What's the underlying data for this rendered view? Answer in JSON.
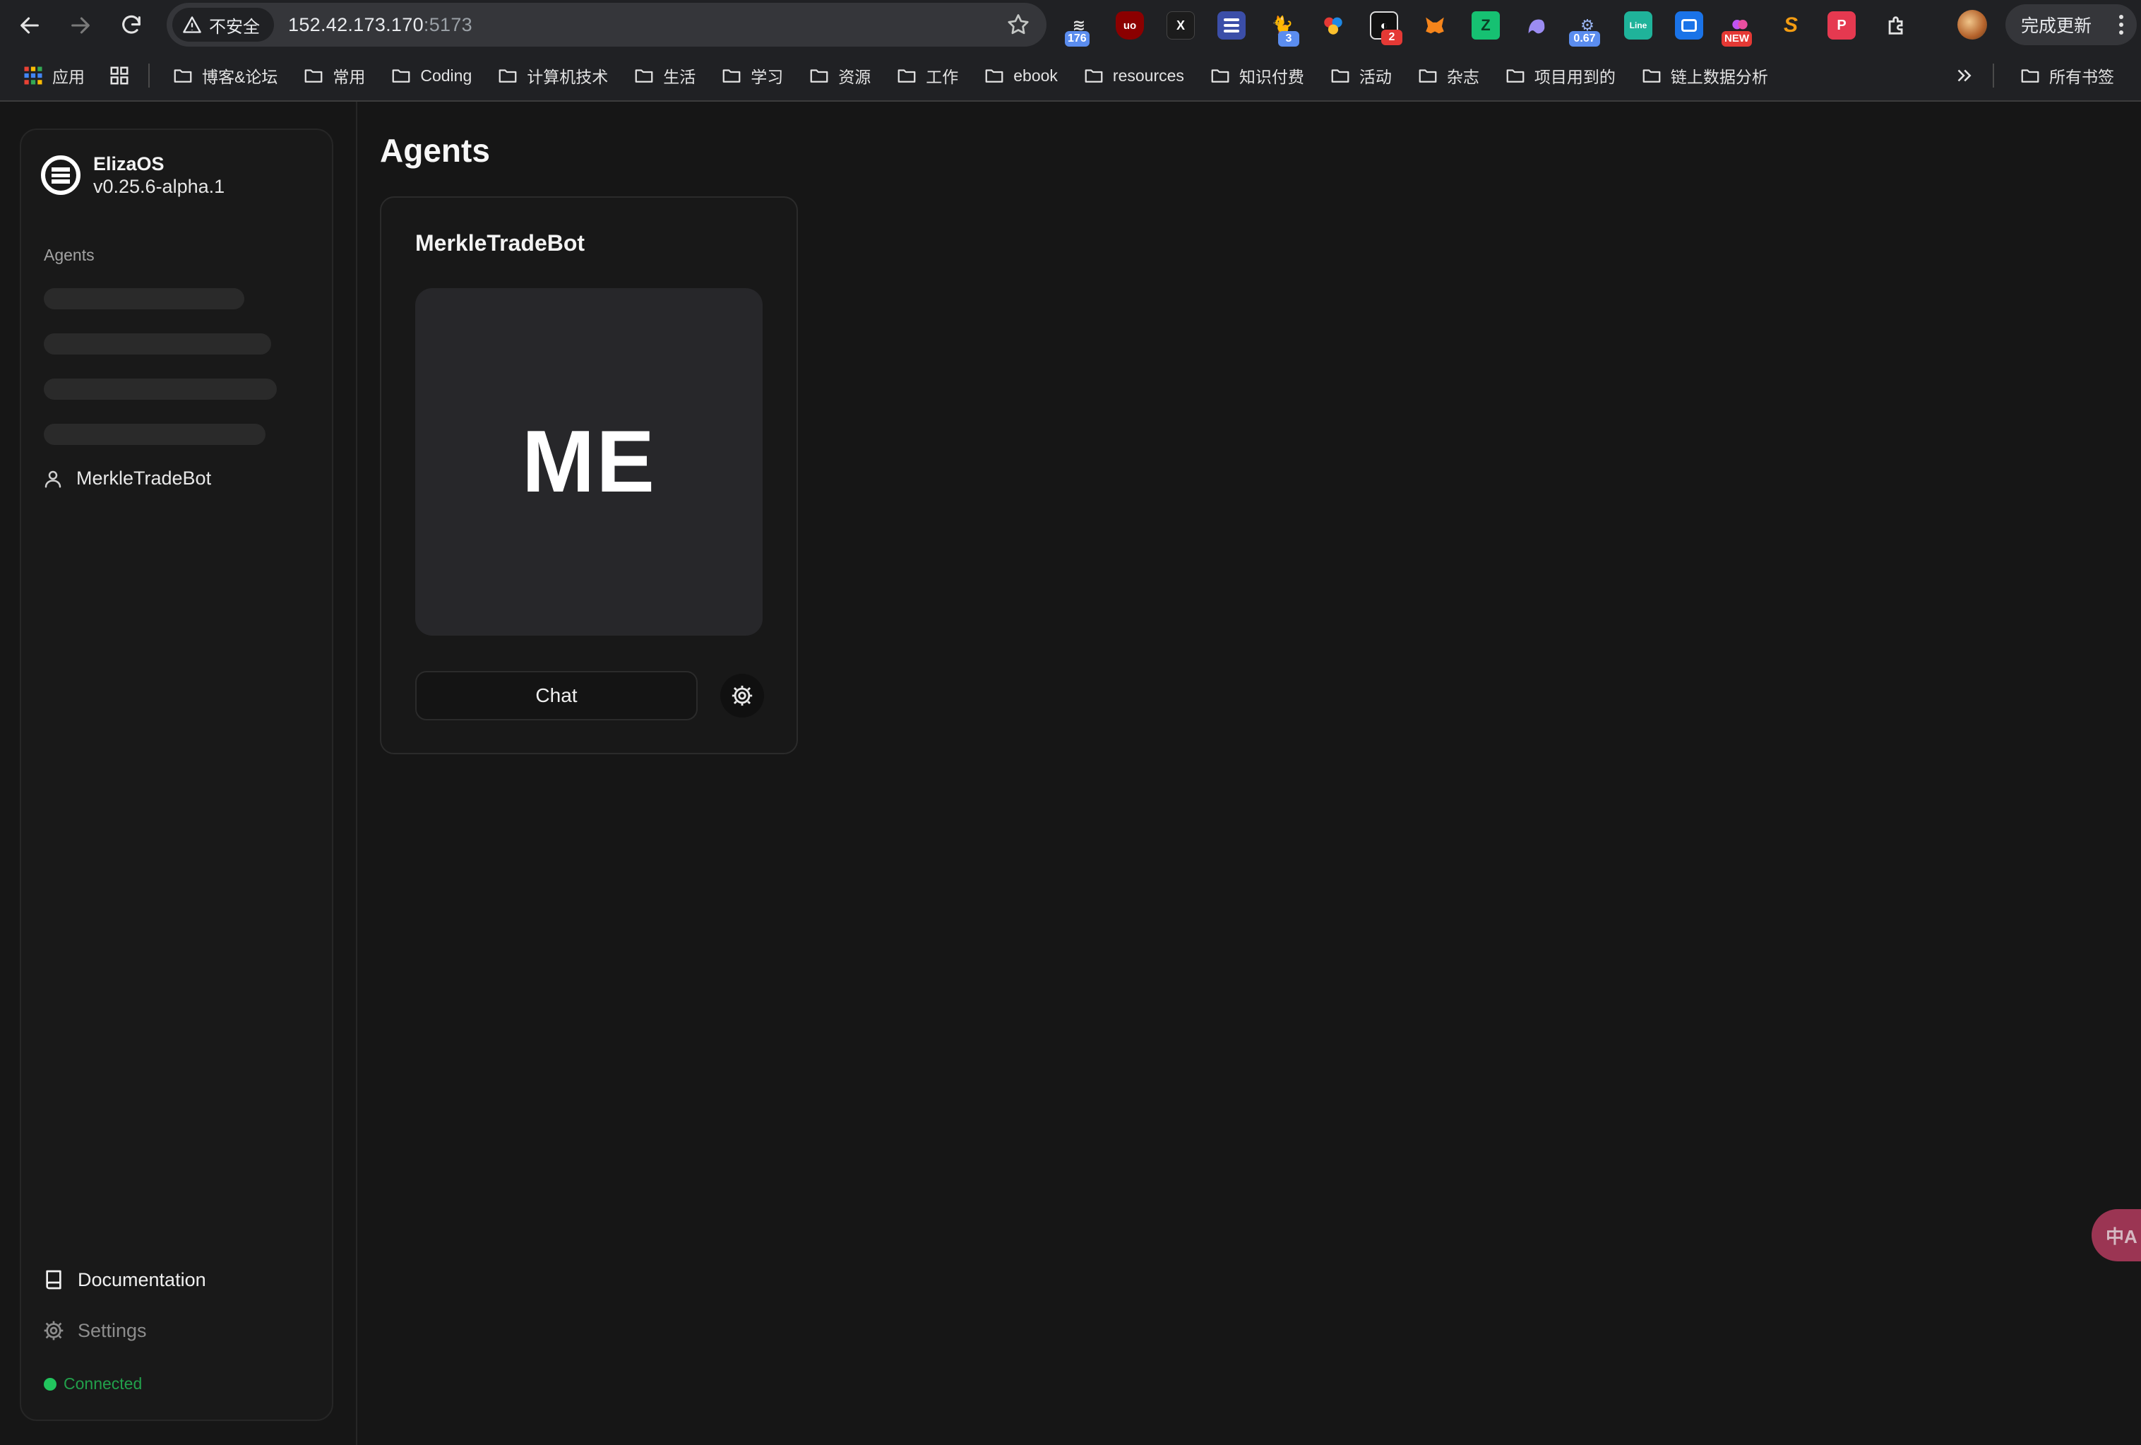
{
  "browser": {
    "security_label": "不安全",
    "url_host": "152.42.173.170",
    "url_port": ":5173",
    "update_label": "完成更新",
    "extensions": [
      {
        "name": "ext-1",
        "badge": "176"
      },
      {
        "name": "ext-ublock",
        "glyph": "uo"
      },
      {
        "name": "ext-x",
        "glyph": "X"
      },
      {
        "name": "ext-list",
        "glyph": ""
      },
      {
        "name": "ext-cat",
        "badge": "3"
      },
      {
        "name": "ext-flower",
        "glyph": ""
      },
      {
        "name": "ext-circle",
        "badge": "2"
      },
      {
        "name": "ext-metamask",
        "glyph": ""
      },
      {
        "name": "ext-green",
        "glyph": ""
      },
      {
        "name": "ext-ghost",
        "glyph": ""
      },
      {
        "name": "ext-robot",
        "badge": "0.67"
      },
      {
        "name": "ext-line",
        "glyph": "Line"
      },
      {
        "name": "ext-blue",
        "glyph": ""
      },
      {
        "name": "ext-new",
        "badge": "NEW"
      },
      {
        "name": "ext-s",
        "glyph": "S"
      },
      {
        "name": "ext-red",
        "glyph": "P"
      }
    ]
  },
  "bookmarks": {
    "apps": "应用",
    "items": [
      "博客&论坛",
      "常用",
      "Coding",
      "计算机技术",
      "生活",
      "学习",
      "资源",
      "工作",
      "ebook",
      "resources",
      "知识付费",
      "活动",
      "杂志",
      "项目用到的",
      "链上数据分析"
    ],
    "all": "所有书签"
  },
  "sidebar": {
    "brand_name": "ElizaOS",
    "brand_version": "v0.25.6-alpha.1",
    "section_label": "Agents",
    "agent_name": "MerkleTradeBot",
    "documentation": "Documentation",
    "settings": "Settings",
    "status": "Connected"
  },
  "main": {
    "title": "Agents",
    "card": {
      "name": "MerkleTradeBot",
      "initials": "ME",
      "chat_label": "Chat"
    }
  },
  "translate_fab": "中A"
}
